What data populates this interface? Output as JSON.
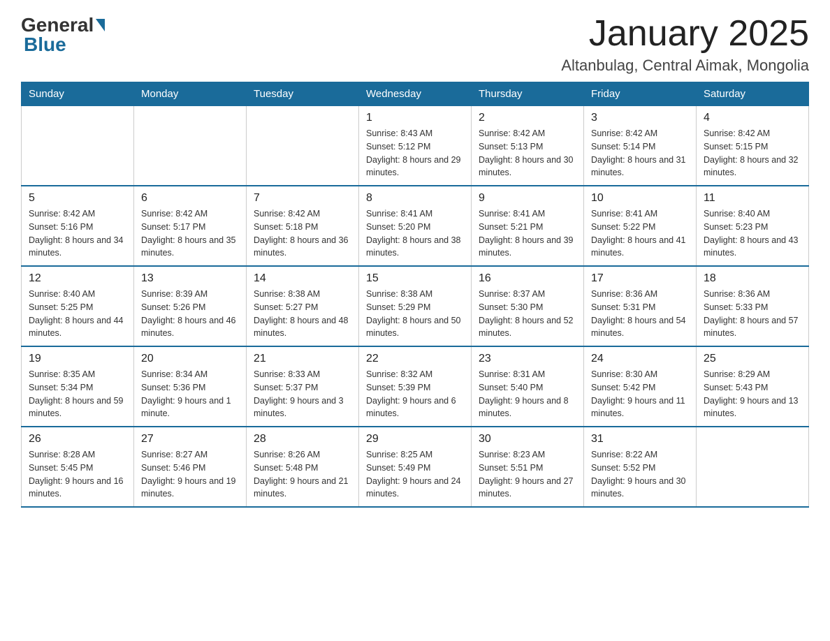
{
  "header": {
    "logo_general": "General",
    "logo_blue": "Blue",
    "month_title": "January 2025",
    "location": "Altanbulag, Central Aimak, Mongolia"
  },
  "days_of_week": [
    "Sunday",
    "Monday",
    "Tuesday",
    "Wednesday",
    "Thursday",
    "Friday",
    "Saturday"
  ],
  "weeks": [
    [
      {
        "day": "",
        "sunrise": "",
        "sunset": "",
        "daylight": ""
      },
      {
        "day": "",
        "sunrise": "",
        "sunset": "",
        "daylight": ""
      },
      {
        "day": "",
        "sunrise": "",
        "sunset": "",
        "daylight": ""
      },
      {
        "day": "1",
        "sunrise": "Sunrise: 8:43 AM",
        "sunset": "Sunset: 5:12 PM",
        "daylight": "Daylight: 8 hours and 29 minutes."
      },
      {
        "day": "2",
        "sunrise": "Sunrise: 8:42 AM",
        "sunset": "Sunset: 5:13 PM",
        "daylight": "Daylight: 8 hours and 30 minutes."
      },
      {
        "day": "3",
        "sunrise": "Sunrise: 8:42 AM",
        "sunset": "Sunset: 5:14 PM",
        "daylight": "Daylight: 8 hours and 31 minutes."
      },
      {
        "day": "4",
        "sunrise": "Sunrise: 8:42 AM",
        "sunset": "Sunset: 5:15 PM",
        "daylight": "Daylight: 8 hours and 32 minutes."
      }
    ],
    [
      {
        "day": "5",
        "sunrise": "Sunrise: 8:42 AM",
        "sunset": "Sunset: 5:16 PM",
        "daylight": "Daylight: 8 hours and 34 minutes."
      },
      {
        "day": "6",
        "sunrise": "Sunrise: 8:42 AM",
        "sunset": "Sunset: 5:17 PM",
        "daylight": "Daylight: 8 hours and 35 minutes."
      },
      {
        "day": "7",
        "sunrise": "Sunrise: 8:42 AM",
        "sunset": "Sunset: 5:18 PM",
        "daylight": "Daylight: 8 hours and 36 minutes."
      },
      {
        "day": "8",
        "sunrise": "Sunrise: 8:41 AM",
        "sunset": "Sunset: 5:20 PM",
        "daylight": "Daylight: 8 hours and 38 minutes."
      },
      {
        "day": "9",
        "sunrise": "Sunrise: 8:41 AM",
        "sunset": "Sunset: 5:21 PM",
        "daylight": "Daylight: 8 hours and 39 minutes."
      },
      {
        "day": "10",
        "sunrise": "Sunrise: 8:41 AM",
        "sunset": "Sunset: 5:22 PM",
        "daylight": "Daylight: 8 hours and 41 minutes."
      },
      {
        "day": "11",
        "sunrise": "Sunrise: 8:40 AM",
        "sunset": "Sunset: 5:23 PM",
        "daylight": "Daylight: 8 hours and 43 minutes."
      }
    ],
    [
      {
        "day": "12",
        "sunrise": "Sunrise: 8:40 AM",
        "sunset": "Sunset: 5:25 PM",
        "daylight": "Daylight: 8 hours and 44 minutes."
      },
      {
        "day": "13",
        "sunrise": "Sunrise: 8:39 AM",
        "sunset": "Sunset: 5:26 PM",
        "daylight": "Daylight: 8 hours and 46 minutes."
      },
      {
        "day": "14",
        "sunrise": "Sunrise: 8:38 AM",
        "sunset": "Sunset: 5:27 PM",
        "daylight": "Daylight: 8 hours and 48 minutes."
      },
      {
        "day": "15",
        "sunrise": "Sunrise: 8:38 AM",
        "sunset": "Sunset: 5:29 PM",
        "daylight": "Daylight: 8 hours and 50 minutes."
      },
      {
        "day": "16",
        "sunrise": "Sunrise: 8:37 AM",
        "sunset": "Sunset: 5:30 PM",
        "daylight": "Daylight: 8 hours and 52 minutes."
      },
      {
        "day": "17",
        "sunrise": "Sunrise: 8:36 AM",
        "sunset": "Sunset: 5:31 PM",
        "daylight": "Daylight: 8 hours and 54 minutes."
      },
      {
        "day": "18",
        "sunrise": "Sunrise: 8:36 AM",
        "sunset": "Sunset: 5:33 PM",
        "daylight": "Daylight: 8 hours and 57 minutes."
      }
    ],
    [
      {
        "day": "19",
        "sunrise": "Sunrise: 8:35 AM",
        "sunset": "Sunset: 5:34 PM",
        "daylight": "Daylight: 8 hours and 59 minutes."
      },
      {
        "day": "20",
        "sunrise": "Sunrise: 8:34 AM",
        "sunset": "Sunset: 5:36 PM",
        "daylight": "Daylight: 9 hours and 1 minute."
      },
      {
        "day": "21",
        "sunrise": "Sunrise: 8:33 AM",
        "sunset": "Sunset: 5:37 PM",
        "daylight": "Daylight: 9 hours and 3 minutes."
      },
      {
        "day": "22",
        "sunrise": "Sunrise: 8:32 AM",
        "sunset": "Sunset: 5:39 PM",
        "daylight": "Daylight: 9 hours and 6 minutes."
      },
      {
        "day": "23",
        "sunrise": "Sunrise: 8:31 AM",
        "sunset": "Sunset: 5:40 PM",
        "daylight": "Daylight: 9 hours and 8 minutes."
      },
      {
        "day": "24",
        "sunrise": "Sunrise: 8:30 AM",
        "sunset": "Sunset: 5:42 PM",
        "daylight": "Daylight: 9 hours and 11 minutes."
      },
      {
        "day": "25",
        "sunrise": "Sunrise: 8:29 AM",
        "sunset": "Sunset: 5:43 PM",
        "daylight": "Daylight: 9 hours and 13 minutes."
      }
    ],
    [
      {
        "day": "26",
        "sunrise": "Sunrise: 8:28 AM",
        "sunset": "Sunset: 5:45 PM",
        "daylight": "Daylight: 9 hours and 16 minutes."
      },
      {
        "day": "27",
        "sunrise": "Sunrise: 8:27 AM",
        "sunset": "Sunset: 5:46 PM",
        "daylight": "Daylight: 9 hours and 19 minutes."
      },
      {
        "day": "28",
        "sunrise": "Sunrise: 8:26 AM",
        "sunset": "Sunset: 5:48 PM",
        "daylight": "Daylight: 9 hours and 21 minutes."
      },
      {
        "day": "29",
        "sunrise": "Sunrise: 8:25 AM",
        "sunset": "Sunset: 5:49 PM",
        "daylight": "Daylight: 9 hours and 24 minutes."
      },
      {
        "day": "30",
        "sunrise": "Sunrise: 8:23 AM",
        "sunset": "Sunset: 5:51 PM",
        "daylight": "Daylight: 9 hours and 27 minutes."
      },
      {
        "day": "31",
        "sunrise": "Sunrise: 8:22 AM",
        "sunset": "Sunset: 5:52 PM",
        "daylight": "Daylight: 9 hours and 30 minutes."
      },
      {
        "day": "",
        "sunrise": "",
        "sunset": "",
        "daylight": ""
      }
    ]
  ]
}
